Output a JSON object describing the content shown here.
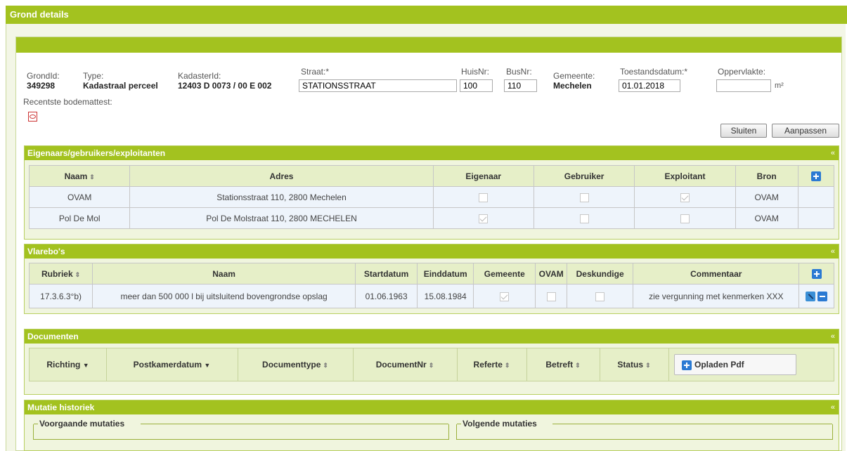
{
  "window": {
    "title": "Grond details"
  },
  "header": {
    "grondid_label": "GrondId:",
    "grondid_value": "349298",
    "type_label": "Type:",
    "type_value": "Kadastraal perceel",
    "kadaster_label": "KadasterId:",
    "kadaster_value": "12403 D 0073 / 00 E 002",
    "straat_label": "Straat:*",
    "straat_value": "STATIONSSTRAAT",
    "huisnr_label": "HuisNr:",
    "huisnr_value": "100",
    "busnr_label": "BusNr:",
    "busnr_value": "110",
    "gemeente_label": "Gemeente:",
    "gemeente_value": "Mechelen",
    "toestand_label": "Toestandsdatum:*",
    "toestand_value": "01.01.2018",
    "opp_label": "Oppervlakte:",
    "opp_value": "",
    "opp_unit": "m²",
    "bodem_label": "Recentste bodemattest:"
  },
  "actions": {
    "sluiten": "Sluiten",
    "aanpassen": "Aanpassen"
  },
  "eigenaars": {
    "title": "Eigenaars/gebruikers/exploitanten",
    "collapse": "«",
    "headers": [
      "Naam",
      "Adres",
      "Eigenaar",
      "Gebruiker",
      "Exploitant",
      "Bron"
    ],
    "rows": [
      {
        "naam": "OVAM",
        "adres": "Stationsstraat 110, 2800 Mechelen",
        "eigenaar": false,
        "gebruiker": false,
        "exploitant": true,
        "bron": "OVAM"
      },
      {
        "naam": "Pol De Mol",
        "adres": "Pol De Molstraat 110, 2800 MECHELEN",
        "eigenaar": true,
        "gebruiker": false,
        "exploitant": false,
        "bron": "OVAM"
      }
    ]
  },
  "vlarebo": {
    "title": "Vlarebo's",
    "collapse": "«",
    "headers": [
      "Rubriek",
      "Naam",
      "Startdatum",
      "Einddatum",
      "Gemeente",
      "OVAM",
      "Deskundige",
      "Commentaar"
    ],
    "rows": [
      {
        "rubriek": "17.3.6.3°b)",
        "naam": "meer dan 500 000 l bij uitsluitend bovengrondse opslag",
        "start": "01.06.1963",
        "eind": "15.08.1984",
        "gemeente": true,
        "ovam": false,
        "deskundige": false,
        "commentaar": "zie vergunning met kenmerken XXX"
      }
    ]
  },
  "documenten": {
    "title": "Documenten",
    "collapse": "«",
    "headers": [
      "Richting",
      "Postkamerdatum",
      "Documenttype",
      "DocumentNr",
      "Referte",
      "Betreft",
      "Status"
    ],
    "upload": "Opladen Pdf"
  },
  "mutatie": {
    "title": "Mutatie historiek",
    "collapse": "«",
    "voorgaande": "Voorgaande mutaties",
    "volgende": "Volgende mutaties"
  }
}
